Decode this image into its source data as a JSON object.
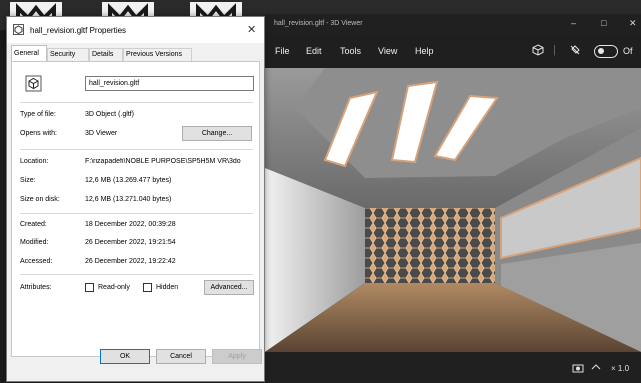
{
  "dialog": {
    "title": "hall_revision.gltf Properties",
    "tabs": [
      {
        "label": "General",
        "active": true
      },
      {
        "label": "Security"
      },
      {
        "label": "Details"
      },
      {
        "label": "Previous Versions"
      }
    ],
    "file_name": "hall_revision.gltf",
    "fields": {
      "type_label": "Type of file:",
      "type_value": "3D Object (.gltf)",
      "opens_label": "Opens with:",
      "opens_value": "3D Viewer",
      "change_button": "Change...",
      "location_label": "Location:",
      "location_value": "F:\\rizapadefi\\NOBLE PURPOSE\\SP5H5M VR\\3do",
      "size_label": "Size:",
      "size_value": "12,6 MB (13.269.477 bytes)",
      "size_disk_label": "Size on disk:",
      "size_disk_value": "12,6 MB (13.271.040 bytes)",
      "created_label": "Created:",
      "created_value": "18 December 2022, 00:39:28",
      "modified_label": "Modified:",
      "modified_value": "26 December 2022, 19:21:54",
      "accessed_label": "Accessed:",
      "accessed_value": "26 December 2022, 19:22:42",
      "attributes_label": "Attributes:",
      "readonly_label": "Read-only",
      "hidden_label": "Hidden",
      "advanced_button": "Advanced..."
    },
    "buttons": {
      "ok": "OK",
      "cancel": "Cancel",
      "apply": "Apply"
    }
  },
  "viewer": {
    "title": "hall_revision.gltf - 3D Viewer",
    "menu": [
      "File",
      "Edit",
      "Tools",
      "View",
      "Help"
    ],
    "toggle_text": "Of",
    "zoom": "× 1.0",
    "window_controls": {
      "minimize": "–",
      "maximize": "□",
      "close": "✕"
    }
  },
  "colors": {
    "accent": "#0078d7",
    "viewer_bg": "#1f1f1f",
    "dialog_bg": "#f0f0f0"
  }
}
